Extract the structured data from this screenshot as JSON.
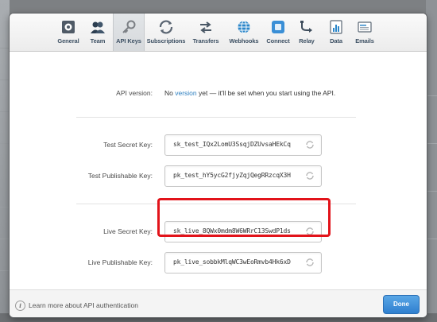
{
  "toolbar": {
    "items": [
      {
        "label": "General",
        "icon": "general-icon"
      },
      {
        "label": "Team",
        "icon": "team-icon"
      },
      {
        "label": "API Keys",
        "icon": "key-icon"
      },
      {
        "label": "Subscriptions",
        "icon": "subscriptions-icon"
      },
      {
        "label": "Transfers",
        "icon": "transfers-icon"
      },
      {
        "label": "Webhooks",
        "icon": "webhooks-icon"
      },
      {
        "label": "Connect",
        "icon": "connect-icon"
      },
      {
        "label": "Relay",
        "icon": "relay-icon"
      },
      {
        "label": "Data",
        "icon": "data-icon"
      },
      {
        "label": "Emails",
        "icon": "emails-icon"
      }
    ],
    "active": "API Keys"
  },
  "api_version": {
    "label": "API version:",
    "prefix": "No ",
    "link": "version",
    "suffix": " yet — it'll be set when you start using the API."
  },
  "keys": {
    "test_secret": {
      "label": "Test Secret Key:",
      "value": "sk_test_IQx2LomU3SsqjDZUvsaHEkCq"
    },
    "test_publishable": {
      "label": "Test Publishable Key:",
      "value": "pk_test_hY5ycG2fjyZqjQegRRzcqX3H"
    },
    "live_secret": {
      "label": "Live Secret Key:",
      "value": "sk_live_8QWx0mdm8W6WRrC13SwdP1ds"
    },
    "live_publishable": {
      "label": "Live Publishable Key:",
      "value": "pk_live_sobbkMlqWC3wEoRmvb4Hk6xD"
    }
  },
  "footer": {
    "info_icon": "i",
    "learn_more": "Learn more about API authentication",
    "done": "Done"
  },
  "colors": {
    "accent": "#2d7fc0",
    "highlight": "#e2131a",
    "done_button": "#3a8ad8"
  }
}
